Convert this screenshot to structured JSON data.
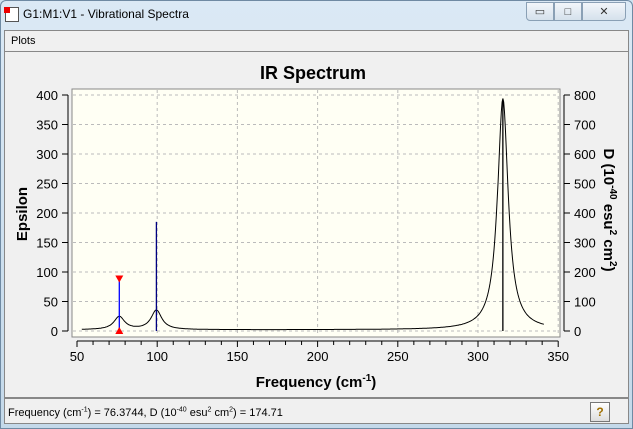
{
  "window": {
    "title": "G1:M1:V1 - Vibrational Spectra",
    "minimize": "▭",
    "maximize": "□",
    "close": "✕"
  },
  "menu": {
    "plots": "Plots"
  },
  "status": {
    "freq_label": "Frequency (cm",
    "freq_sup": "-1",
    "mid": ") = 76.3744, D (10",
    "d_sup": "-40",
    "esu": " esu",
    "esu_sup": "2",
    "cm": " cm",
    "cm_sup": "2",
    "end": ") = 174.71",
    "help": "?"
  },
  "chart_data": {
    "type": "line",
    "title": "IR Spectrum",
    "xlabel": "Frequency (cm-1)",
    "ylabel": "Epsilon",
    "y2label": "D (10-40 esu2 cm2)",
    "xlim": [
      50,
      350
    ],
    "ylim": [
      0,
      400
    ],
    "y2lim": [
      0,
      800
    ],
    "xticks": [
      50,
      100,
      150,
      200,
      250,
      300,
      350
    ],
    "yticks": [
      0,
      50,
      100,
      150,
      200,
      250,
      300,
      350,
      400
    ],
    "y2ticks": [
      0,
      100,
      200,
      300,
      400,
      500,
      600,
      700,
      800
    ],
    "grid": true,
    "curve": {
      "range": [
        53,
        341
      ],
      "peaks": [
        {
          "x": 76.37,
          "height": 22
        },
        {
          "x": 99.5,
          "height": 33
        },
        {
          "x": 315.5,
          "height": 392
        }
      ],
      "hwhm": 4
    },
    "sticks": [
      {
        "x": 76.37,
        "d": 174.71,
        "selected": true
      },
      {
        "x": 99.5,
        "d": 370
      },
      {
        "x": 315.5,
        "d": 784
      }
    ],
    "colors": {
      "curve": "#000000",
      "stick": "#000080",
      "selected": "#0000ff",
      "marker": "#ff0000",
      "plot_bg": "#fffff4"
    }
  }
}
